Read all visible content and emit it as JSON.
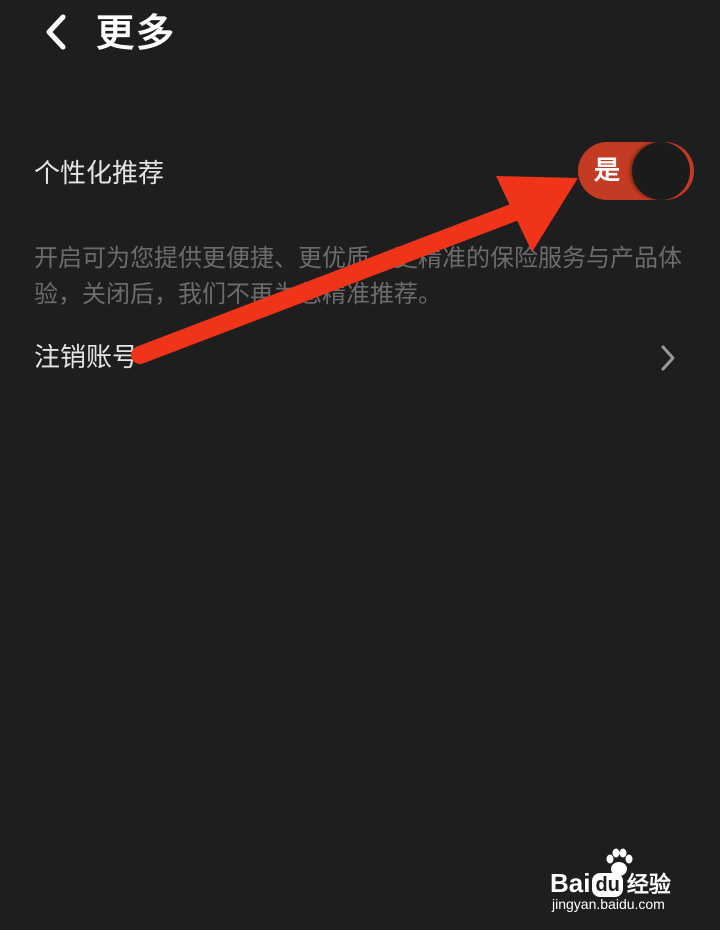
{
  "header": {
    "title": "更多",
    "back_icon": "chevron-left-icon"
  },
  "settings": {
    "personalized": {
      "label": "个性化推荐",
      "toggle_text": "是",
      "toggle_on": true,
      "toggle_color": "#c23b22"
    },
    "description": "开启可为您提供更便捷、更优质、更精准的保险服务与产品体验，关闭后，我们不再为您精准推荐。",
    "cancel_account": {
      "label": "注销账号",
      "icon": "chevron-right-icon"
    }
  },
  "annotation": {
    "icon": "red-arrow-icon",
    "color": "#f0341a"
  },
  "watermark": {
    "brand_left": "Bai",
    "brand_mid": "du",
    "brand_right": "经验",
    "url": "jingyan.baidu.com"
  },
  "colors": {
    "background": "#1e1e1e",
    "primary_text": "#e4e4e4",
    "secondary_text": "#6c6c6c"
  }
}
